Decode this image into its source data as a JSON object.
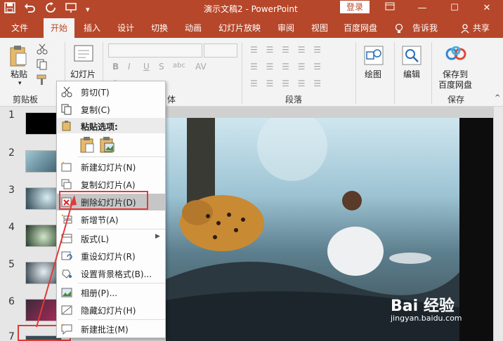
{
  "titlebar": {
    "title": "演示文稿2 - PowerPoint",
    "login_label": "登录",
    "minimize": "—",
    "maximize": "☐",
    "close": "✕"
  },
  "tabs": {
    "file": "文件",
    "home": "开始",
    "insert": "插入",
    "design": "设计",
    "transitions": "切换",
    "animations": "动画",
    "slideshow": "幻灯片放映",
    "review": "审阅",
    "view": "视图",
    "baidu_pan": "百度网盘",
    "tell_me": "告诉我",
    "share": "共享"
  },
  "ribbon": {
    "paste": "粘贴",
    "clipboard": "剪贴板",
    "new_slide": "幻灯片",
    "font_group": "体",
    "paragraph": "段落",
    "drawing": "绘图",
    "editing": "编辑",
    "save_to_line1": "保存到",
    "save_to_line2": "百度网盘",
    "save": "保存"
  },
  "slides": {
    "numbers": [
      "1",
      "2",
      "3",
      "4",
      "5",
      "6",
      "7"
    ]
  },
  "context_menu": {
    "cut": "剪切(T)",
    "copy": "复制(C)",
    "paste_options": "粘贴选项:",
    "new_slide": "新建幻灯片(N)",
    "duplicate_slide": "复制幻灯片(A)",
    "delete_slide": "删除幻灯片(D)",
    "add_section": "新增节(A)",
    "layout": "版式(L)",
    "reset_slide": "重设幻灯片(R)",
    "format_background": "设置背景格式(B)...",
    "photo_album": "相册(P)...",
    "hide_slide": "隐藏幻灯片(H)",
    "new_comment": "新建批注(M)"
  },
  "watermark": {
    "line1": "Bai 经验",
    "line2": "jingyan.baidu.com"
  },
  "colors": {
    "accent": "#b7472a",
    "highlight": "#c6c6c6",
    "annotation": "#e03a3a"
  }
}
